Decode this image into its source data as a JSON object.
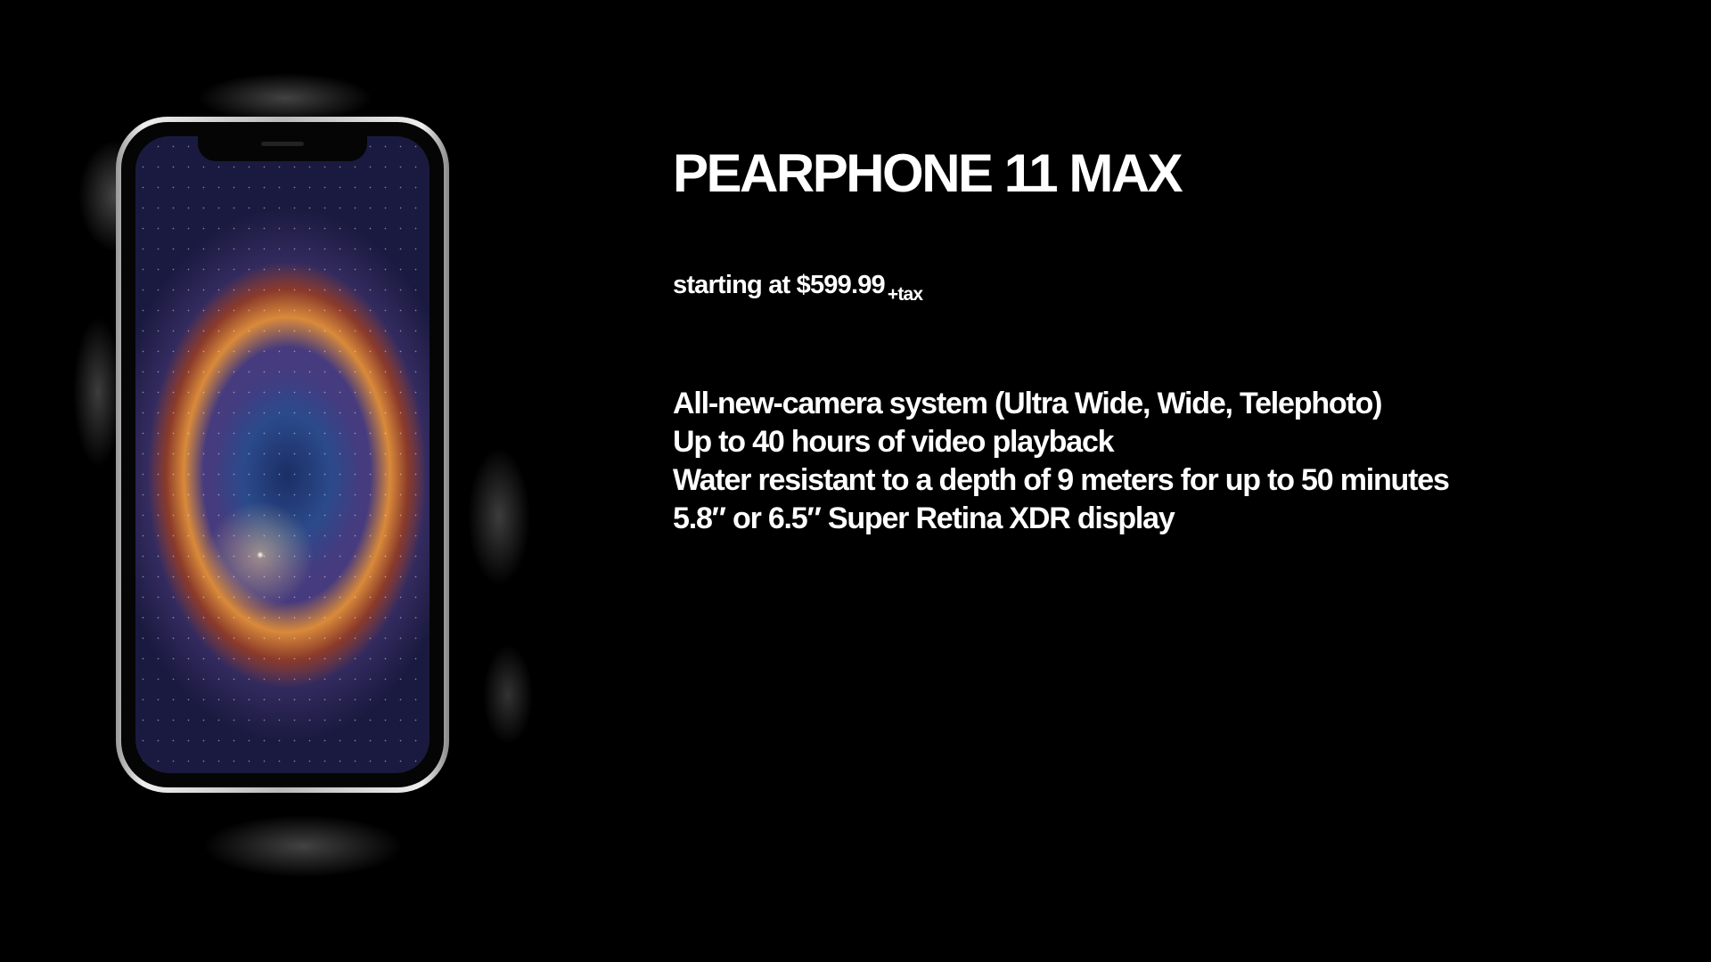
{
  "product": {
    "title": "PEARPHONE 11 MAX",
    "price_prefix": "starting at $599.99",
    "price_suffix": "+tax",
    "features": [
      "All-new-camera system (Ultra Wide, Wide, Telephoto)",
      "Up to 40 hours of video playback",
      "Water resistant to a depth of 9 meters for up to 50 minutes",
      "5.8″ or 6.5″ Super Retina XDR display"
    ]
  },
  "colors": {
    "background": "#000000",
    "text": "#ffffff"
  }
}
